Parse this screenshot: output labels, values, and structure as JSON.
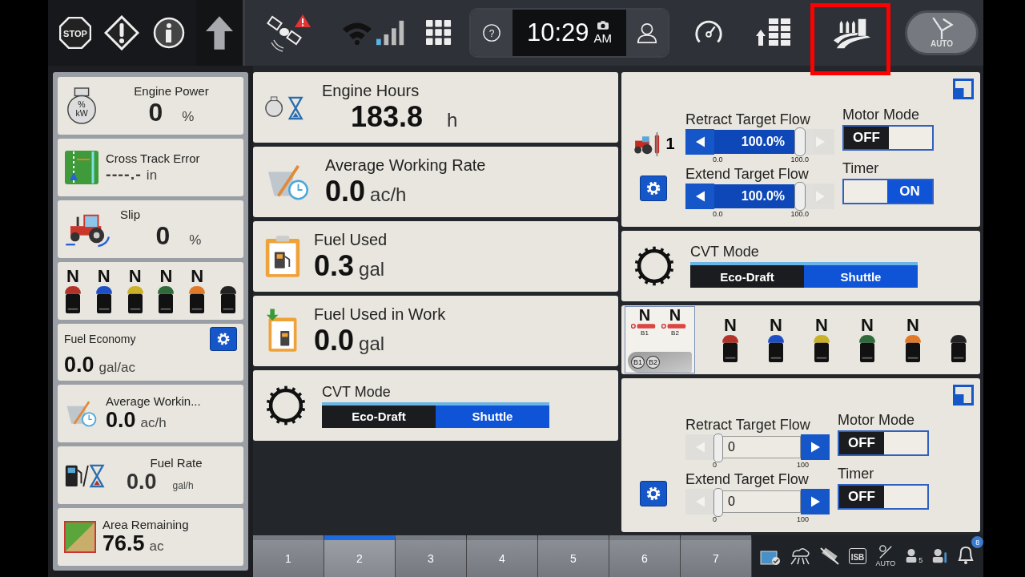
{
  "top_bar": {
    "stop_label": "STOP",
    "help_label": "?",
    "time": "10:29",
    "meridiem": "AM",
    "auto_label": "AUTO"
  },
  "sidebar": {
    "engine_power": {
      "title": "Engine Power",
      "icon_lines": [
        "%",
        "kW"
      ],
      "value": "0",
      "unit": "%"
    },
    "cross_track_error": {
      "title": "Cross Track Error",
      "value": "----.-",
      "unit": "in"
    },
    "slip": {
      "title": "Slip",
      "value": "0",
      "unit": "%"
    },
    "gears": [
      {
        "label": "N",
        "color": "#b3332b"
      },
      {
        "label": "N",
        "color": "#1f4fc4"
      },
      {
        "label": "N",
        "color": "#c9b12a"
      },
      {
        "label": "N",
        "color": "#2f6b3a"
      },
      {
        "label": "N",
        "color": "#e07a2a"
      },
      {
        "color": "#222222"
      }
    ],
    "fuel_economy": {
      "title": "Fuel Economy",
      "value": "0.0",
      "unit": "gal/ac"
    },
    "average_working_rate": {
      "title": "Average Workin...",
      "value": "0.0",
      "unit": "ac/h"
    },
    "fuel_rate": {
      "title": "Fuel Rate",
      "value": "0.0",
      "unit": "gal/h"
    },
    "area_remaining": {
      "title": "Area Remaining",
      "value": "76.5",
      "unit": "ac"
    }
  },
  "main": {
    "engine_hours": {
      "title": "Engine Hours",
      "value": "183.8",
      "unit": "h"
    },
    "average_working_rate": {
      "title": "Average Working Rate",
      "value": "0.0",
      "unit": "ac/h"
    },
    "fuel_used": {
      "title": "Fuel Used",
      "value": "0.3",
      "unit": "gal"
    },
    "fuel_used_in_work": {
      "title": "Fuel Used in Work",
      "value": "0.0",
      "unit": "gal"
    },
    "cvt_mode": {
      "title": "CVT Mode",
      "options": [
        {
          "label": "Eco-Draft",
          "selected": false
        },
        {
          "label": "Shuttle",
          "selected": true
        }
      ]
    }
  },
  "right": {
    "remote_1": {
      "number": "1",
      "flows": [
        {
          "kind": "bar",
          "label": "Retract Target Flow",
          "value": "100.0%",
          "level": 1,
          "min": "0.0",
          "max": "100.0"
        },
        {
          "kind": "bar",
          "label": "Extend Target Flow",
          "value": "100.0%",
          "level": 1,
          "min": "0.0",
          "max": "100.0"
        }
      ],
      "toggles": [
        {
          "label": "Motor Mode",
          "on": false,
          "text": "OFF"
        },
        {
          "label": "Timer",
          "on": true,
          "text": "ON"
        }
      ]
    },
    "cvt_mode": {
      "title": "CVT Mode",
      "options": [
        {
          "label": "Eco-Draft",
          "selected": false
        },
        {
          "label": "Shuttle",
          "selected": true
        }
      ]
    },
    "gear_panel": {
      "levers": [
        {
          "label": "N",
          "tag": "B1"
        },
        {
          "label": "N",
          "tag": "B2"
        }
      ],
      "joystick_buttons": [
        "B1",
        "B2"
      ],
      "gears": [
        {
          "label": "N",
          "color": "#b3332b"
        },
        {
          "label": "N",
          "color": "#1f4fc4"
        },
        {
          "label": "N",
          "color": "#c9b12a"
        },
        {
          "label": "N",
          "color": "#2f6b3a"
        },
        {
          "label": "N",
          "color": "#e07a2a"
        },
        {
          "color": "#222222"
        }
      ]
    },
    "remote_2": {
      "flows": [
        {
          "kind": "field",
          "label": "Retract Target Flow",
          "value": "0",
          "level": 0,
          "min": "0",
          "max": "100"
        },
        {
          "kind": "field",
          "label": "Extend Target Flow",
          "value": "0",
          "level": 0,
          "min": "0",
          "max": "100"
        }
      ],
      "toggles": [
        {
          "label": "Motor Mode",
          "on": false,
          "text": "OFF"
        },
        {
          "label": "Timer",
          "on": false,
          "text": "OFF"
        }
      ]
    }
  },
  "tabs": [
    {
      "label": "1",
      "selected": false
    },
    {
      "label": "2",
      "selected": true
    },
    {
      "label": "3",
      "selected": false
    },
    {
      "label": "4",
      "selected": false
    },
    {
      "label": "5",
      "selected": false
    },
    {
      "label": "6",
      "selected": false
    },
    {
      "label": "7",
      "selected": false
    }
  ],
  "status_bar": {
    "isb": "ISB",
    "auto": "AUTO",
    "count": "5",
    "notifications": "8"
  }
}
